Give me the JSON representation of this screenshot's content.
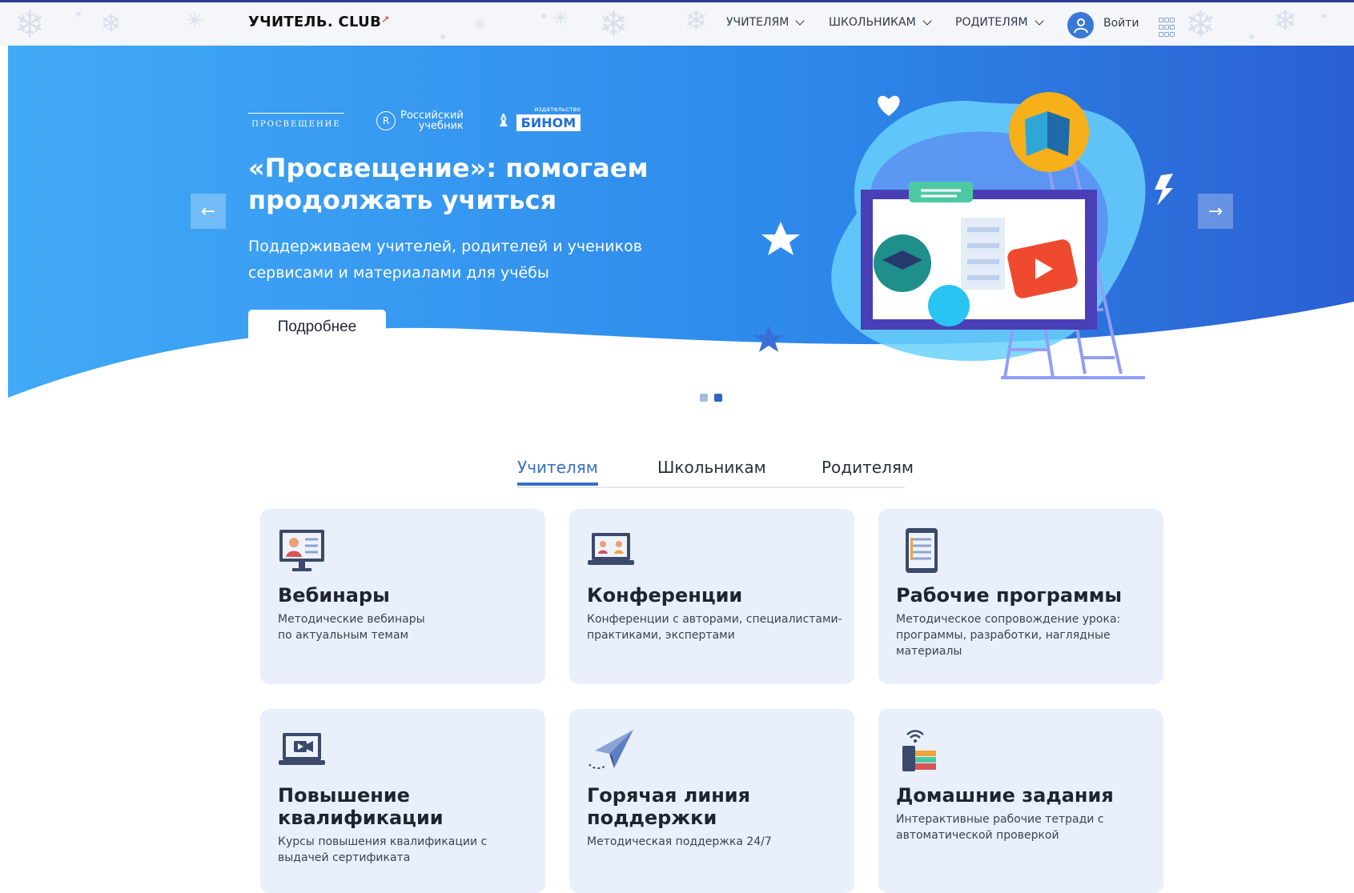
{
  "header": {
    "logo_text": "УЧИТЕЛЬ. CLUB",
    "nav": [
      {
        "label": "УЧИТЕЛЯМ"
      },
      {
        "label": "ШКОЛЬНИКАМ"
      },
      {
        "label": "РОДИТЕЛЯМ"
      }
    ],
    "login_label": "Войти"
  },
  "hero": {
    "partners": {
      "prosveshchenie": "ПРОСВЕЩЕНИЕ",
      "rus_line1": "Российский",
      "rus_line2": "учебник",
      "binom_small": "издательство",
      "binom": "БИНОМ"
    },
    "title": "«Просвещение»: помогаем продолжать учиться",
    "subtitle": "Поддерживаем учителей, родителей и учеников сервисами и материалами для учёбы",
    "button_label": "Подробнее",
    "slides_total": 2,
    "slide_active": 2
  },
  "tabs": [
    {
      "label": "Учителям",
      "active": true
    },
    {
      "label": "Школьникам",
      "active": false
    },
    {
      "label": "Родителям",
      "active": false
    }
  ],
  "cards": [
    {
      "icon": "webinar-monitor-icon",
      "title": "Вебинары",
      "desc": "Методические вебинары по актуальным темам"
    },
    {
      "icon": "conference-laptop-icon",
      "title": "Конференции",
      "desc": "Конференции с авторами, специалистами-практиками, экспертами"
    },
    {
      "icon": "tablet-document-icon",
      "title": "Рабочие программы",
      "desc": "Методическое сопровождение урока: программы, разработки, наглядные материалы"
    },
    {
      "icon": "video-laptop-icon",
      "title": "Повышение квалификации",
      "desc": "Курсы повышения квалификации с выдачей сертификата"
    },
    {
      "icon": "paper-plane-icon",
      "title": "Горячая линия поддержки",
      "desc": "Методическая поддержка 24/7"
    },
    {
      "icon": "books-wifi-icon",
      "title": "Домашние задания",
      "desc": "Интерактивные рабочие тетради с автоматической проверкой"
    }
  ],
  "colors": {
    "accent": "#3a6fc4",
    "hero_blue": "#2f8ef0",
    "card_bg": "#e9f0fb",
    "header_border": "#2b3a8f"
  }
}
